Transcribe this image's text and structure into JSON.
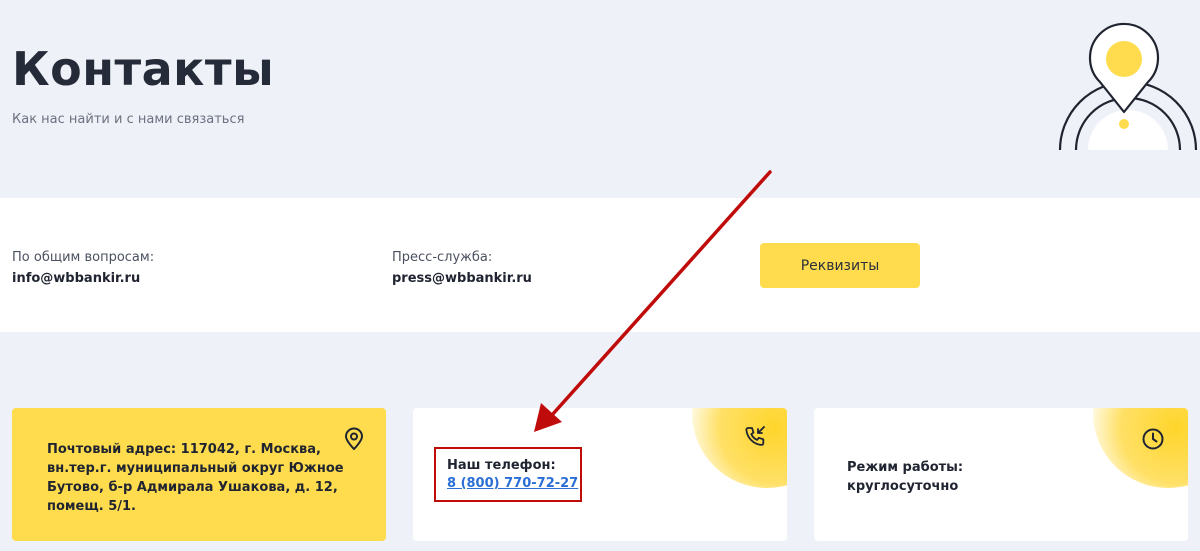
{
  "header": {
    "title": "Контакты",
    "subtitle": "Как нас найти и с нами связаться",
    "illustration_icon": "map-pin-icon"
  },
  "contacts": {
    "general": {
      "label": "По общим вопросам:",
      "email": "info@wbbankir.ru"
    },
    "press": {
      "label": "Пресс-служба:",
      "email": "press@wbbankir.ru"
    },
    "requisites_button": "Реквизиты"
  },
  "cards": {
    "address": {
      "icon": "location-pin-icon",
      "text": "Почтовый адрес: 117042, г. Москва, вн.тер.г. муниципальный округ Южное Бутово, б-р Адмирала Ушакова, д. 12, помещ. 5/1."
    },
    "phone": {
      "icon": "incoming-call-icon",
      "label": "Наш телефон:",
      "number": "8 (800) 770-72-27"
    },
    "hours": {
      "icon": "clock-icon",
      "label": "Режим работы:",
      "value": "круглосуточно"
    }
  },
  "colors": {
    "accent_yellow": "#ffdc4d",
    "background": "#eef1f7",
    "annotation_red": "#c00b0b",
    "link_blue": "#2b6fd6"
  }
}
